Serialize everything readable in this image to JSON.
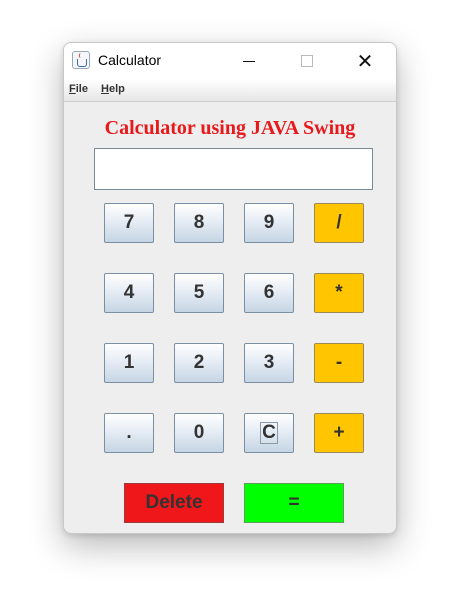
{
  "window": {
    "title": "Calculator",
    "icon": "java-cup-icon"
  },
  "menu": [
    {
      "mnemonic": "F",
      "rest": "ile"
    },
    {
      "mnemonic": "H",
      "rest": "elp"
    }
  ],
  "heading": "Calculator using JAVA Swing",
  "display": {
    "value": ""
  },
  "keys": {
    "seven": "7",
    "eight": "8",
    "nine": "9",
    "divide": "/",
    "four": "4",
    "five": "5",
    "six": "6",
    "multiply": "*",
    "one": "1",
    "two": "2",
    "three": "3",
    "subtract": "-",
    "dot": ".",
    "zero": "0",
    "clear": "C",
    "add": "+"
  },
  "actions": {
    "delete": "Delete",
    "equals": "="
  },
  "colors": {
    "heading": "#e8191b",
    "operator": "#ffc600",
    "delete": "#f0171a",
    "equals": "#00ff00"
  }
}
